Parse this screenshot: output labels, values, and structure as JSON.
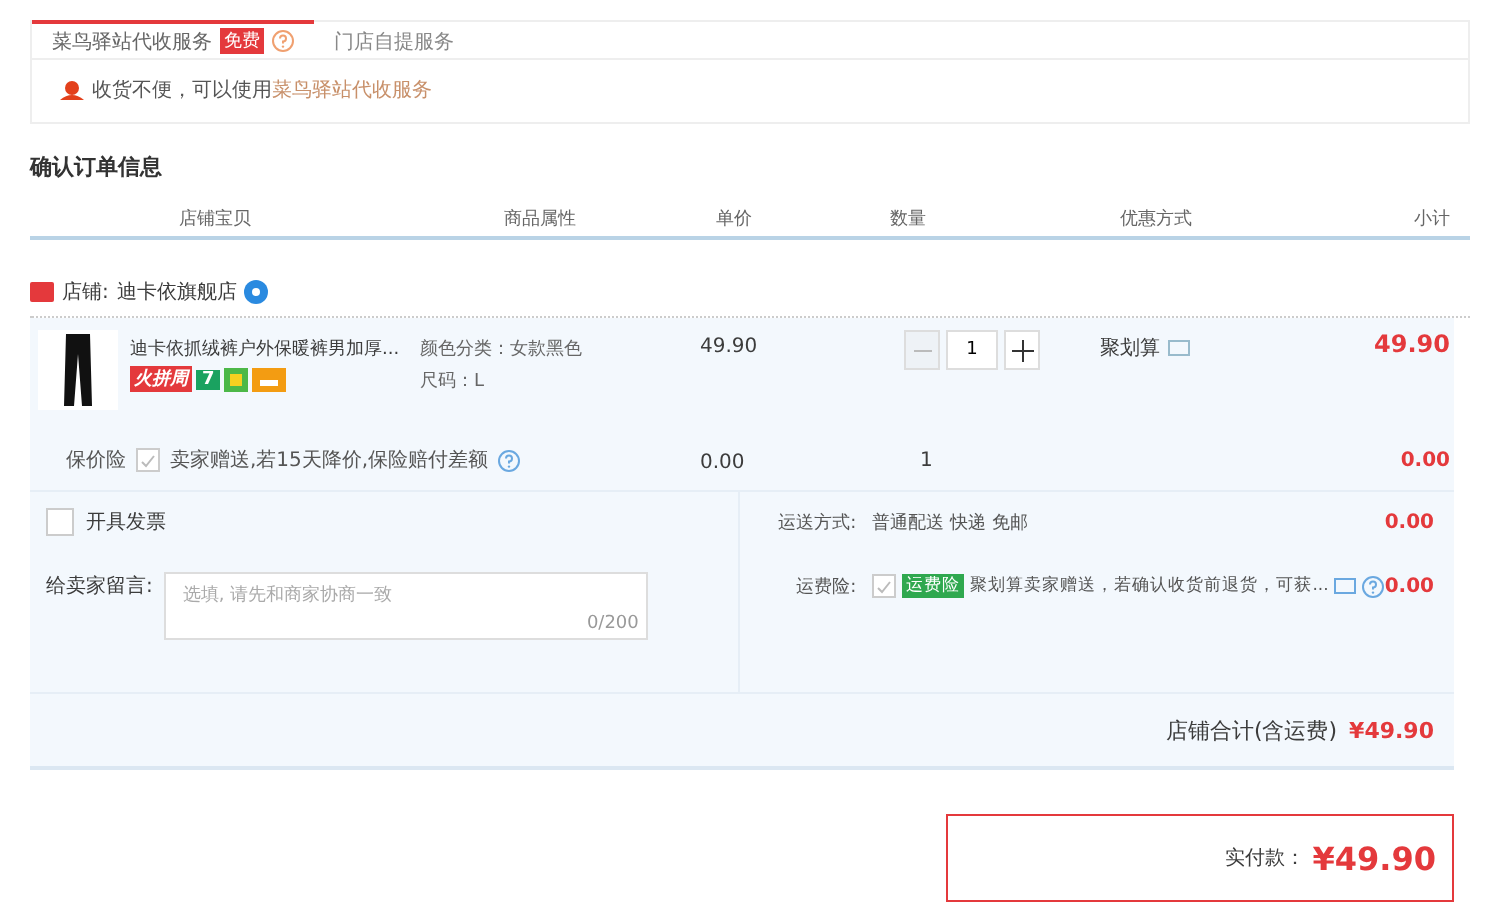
{
  "delivery_tabs": [
    {
      "label": "菜鸟驿站代收服务",
      "badge": "免费",
      "selected": true
    },
    {
      "label": "门店自提服务",
      "selected": false
    }
  ],
  "delivery_notice": {
    "text": "收货不便，可以使用",
    "link": "菜鸟驿站代收服务"
  },
  "section_title": "确认订单信息",
  "columns": [
    "店铺宝贝",
    "商品属性",
    "单价",
    "数量",
    "优惠方式",
    "小计"
  ],
  "shop": {
    "label": "店铺:",
    "name": "迪卡依旗舰店"
  },
  "item": {
    "title": "迪卡依抓绒裤户外保暖裤男加厚...",
    "promo_tag": "火拼周",
    "service_badge": "7",
    "attributes": [
      "颜色分类：女款黑色",
      "尺码：L"
    ],
    "price": "49.90",
    "quantity": "1",
    "discount": "聚划算",
    "subtotal": "49.90"
  },
  "price_insurance": {
    "label": "保价险",
    "checked": true,
    "text": "卖家赠送,若15天降价,保险赔付差额",
    "price": "0.00",
    "quantity": "1",
    "subtotal": "0.00"
  },
  "invoice": {
    "label": "开具发票",
    "checked": false
  },
  "shipping": {
    "label": "运送方式:",
    "value": "普通配送 快递 免邮",
    "subtotal": "0.00"
  },
  "message": {
    "label": "给卖家留言:",
    "placeholder": "选填, 请先和商家协商一致",
    "counter": "0/200"
  },
  "return_insurance": {
    "label": "运费险:",
    "checked": true,
    "tag": "运费险",
    "text": "聚划算卖家赠送，若确认收货前退货，可获...",
    "subtotal": "0.00"
  },
  "shop_total": {
    "label": "店铺合计(含运费)",
    "value": "¥49.90"
  },
  "payment": {
    "label": "实付款：",
    "value": "¥49.90"
  }
}
